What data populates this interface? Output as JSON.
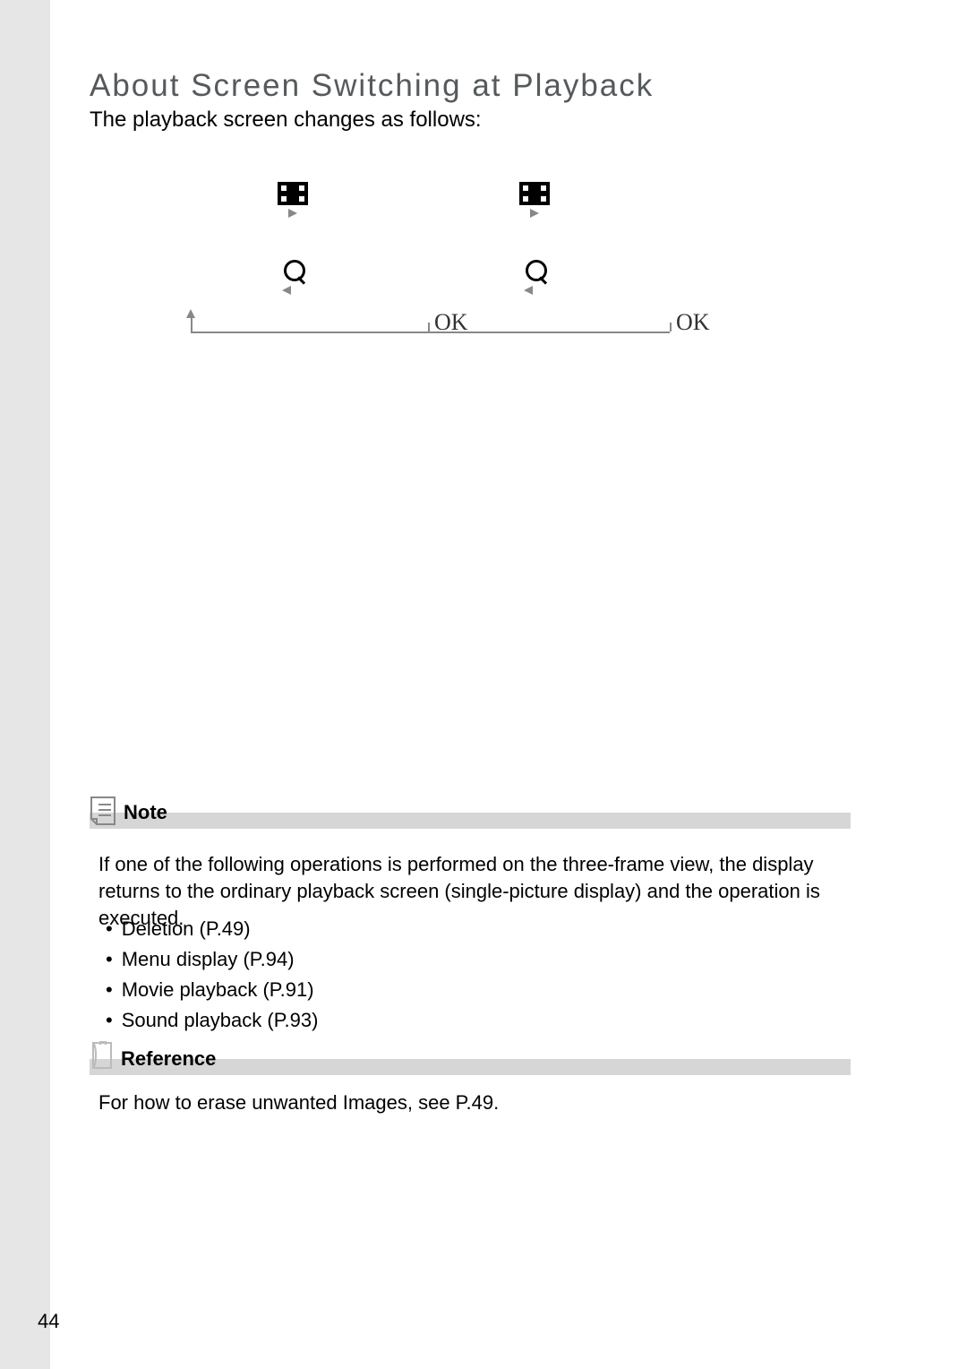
{
  "heading": "About Screen Switching at Playback",
  "subhead": "The playback screen changes as follows:",
  "diagram": {
    "ok1": "OK",
    "ok2": "OK"
  },
  "note": {
    "label": "Note",
    "paragraph": "If one of the following operations is performed on the three-frame view, the display returns to the ordinary playback screen (single-picture display) and the operation is executed.",
    "bullets": [
      "Deletion (P.49)",
      "Menu display (P.94)",
      "Movie playback (P.91)",
      "Sound playback (P.93)"
    ]
  },
  "reference": {
    "label": "Reference",
    "paragraph": "For how to erase unwanted Images, see P.49."
  },
  "page_number": "44"
}
